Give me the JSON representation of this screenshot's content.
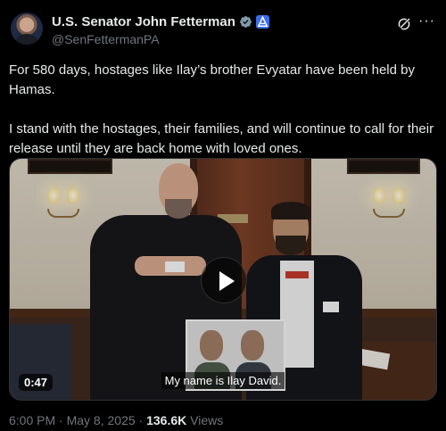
{
  "author": {
    "display_name": "U.S. Senator John Fetterman",
    "handle": "@SenFettermanPA",
    "avatar_icon": "profile-photo",
    "verified_icon": "gray-verified-badge",
    "affiliation_icon": "government-affiliation-badge"
  },
  "actions": {
    "grok_icon": "grok-icon",
    "more_label": "···"
  },
  "tweet": {
    "paragraph_1": "For 580 days, hostages like Ilay’s brother Evyatar have been held by Hamas.",
    "paragraph_2": "I stand with the hostages, their families, and will continue to call for their release until they are back home with loved ones."
  },
  "video": {
    "duration": "0:47",
    "caption": "My name is Ilay David.",
    "play_icon": "play-icon"
  },
  "meta": {
    "time": "6:00 PM",
    "separator": "·",
    "date": "May 8, 2025",
    "views_count": "136.6K",
    "views_label": "Views"
  },
  "colors": {
    "background": "#000000",
    "text": "#e7e9ea",
    "secondary_text": "#71767b",
    "verified_gray": "#829aab",
    "affiliation_blue": "#3b6ee8"
  }
}
